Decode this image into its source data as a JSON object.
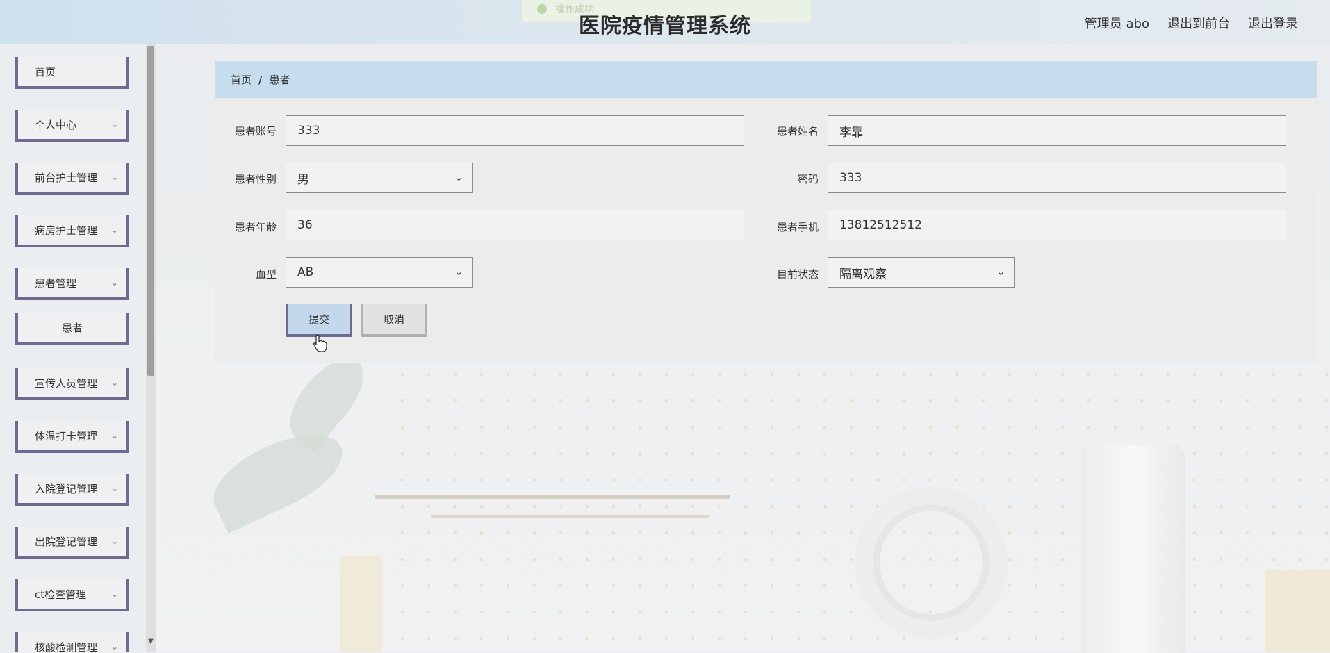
{
  "header": {
    "title": "医院疫情管理系统",
    "toast": "操作成功",
    "nav": [
      "管理员 abo",
      "退出到前台",
      "退出登录"
    ]
  },
  "sidebar": {
    "items": [
      {
        "label": "首页"
      },
      {
        "label": "个人中心"
      },
      {
        "label": "前台护士管理"
      },
      {
        "label": "病房护士管理"
      },
      {
        "label": "患者管理"
      },
      {
        "label": "患者"
      },
      {
        "label": "宣传人员管理"
      },
      {
        "label": "体温打卡管理"
      },
      {
        "label": "入院登记管理"
      },
      {
        "label": "出院登记管理"
      },
      {
        "label": "ct检查管理"
      },
      {
        "label": "核酸检测管理"
      }
    ]
  },
  "breadcrumb": {
    "home": "首页",
    "sep": "/",
    "current": "患者"
  },
  "form": {
    "account_label": "患者账号",
    "account_value": "333",
    "name_label": "患者姓名",
    "name_value": "李靠",
    "gender_label": "患者性别",
    "gender_value": "男",
    "password_label": "密码",
    "password_value": "333",
    "age_label": "患者年龄",
    "age_value": "36",
    "phone_label": "患者手机",
    "phone_value": "13812512512",
    "blood_label": "血型",
    "blood_value": "AB",
    "status_label": "目前状态",
    "status_value": "隔离观察"
  },
  "buttons": {
    "submit": "提交",
    "cancel": "取消"
  },
  "colors": {
    "accent": "#6e6a92",
    "breadcrumb_bg": "#c6ddee",
    "submit_bg": "#c3d8ea"
  }
}
